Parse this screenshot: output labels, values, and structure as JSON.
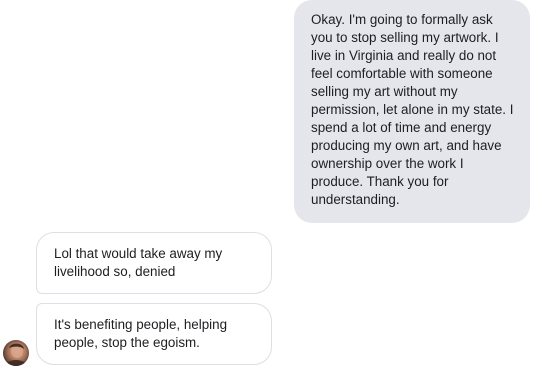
{
  "messages": {
    "sent": [
      {
        "text": "Okay. I'm going to formally ask you to stop selling my artwork. I live in Virginia and really do not feel comfortable with someone selling my art without my permission, let alone in my state. I spend a lot of time and energy producing my own art, and have ownership over the work I produce. Thank you for understanding."
      }
    ],
    "received": [
      {
        "text": "Lol that would take away my livelihood so, denied"
      },
      {
        "text": "It's benefiting people, helping people, stop the egoism."
      }
    ]
  },
  "colors": {
    "sent_bubble": "#e4e6eb",
    "received_bubble": "#ffffff",
    "received_border": "#dcdfe4",
    "text": "#1c1e21"
  },
  "icons": {
    "avatar": "user-avatar-photo"
  }
}
